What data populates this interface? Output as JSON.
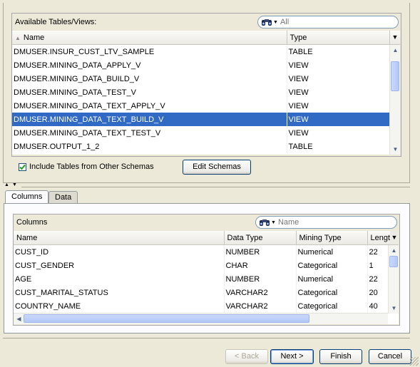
{
  "tables_panel": {
    "title": "Available Tables/Views:",
    "search_placeholder": "All",
    "columns": [
      "Name",
      "Type"
    ],
    "rows": [
      {
        "name": "DMUSER.INSUR_CUST_LTV_SAMPLE",
        "type": "TABLE"
      },
      {
        "name": "DMUSER.MINING_DATA_APPLY_V",
        "type": "VIEW"
      },
      {
        "name": "DMUSER.MINING_DATA_BUILD_V",
        "type": "VIEW"
      },
      {
        "name": "DMUSER.MINING_DATA_TEST_V",
        "type": "VIEW"
      },
      {
        "name": "DMUSER.MINING_DATA_TEXT_APPLY_V",
        "type": "VIEW"
      },
      {
        "name": "DMUSER.MINING_DATA_TEXT_BUILD_V",
        "type": "VIEW"
      },
      {
        "name": "DMUSER.MINING_DATA_TEXT_TEST_V",
        "type": "VIEW"
      },
      {
        "name": "DMUSER.OUTPUT_1_2",
        "type": "TABLE"
      }
    ],
    "selected_index": 5,
    "include_other_schemas_label": "Include Tables from Other Schemas",
    "include_other_schemas_checked": true,
    "edit_schemas_label": "Edit Schemas"
  },
  "tabs": [
    "Columns",
    "Data"
  ],
  "active_tab": 0,
  "columns_panel": {
    "title": "Columns",
    "search_placeholder": "Name",
    "headers": [
      "Name",
      "Data Type",
      "Mining Type",
      "Lengt"
    ],
    "rows": [
      {
        "name": "CUST_ID",
        "data_type": "NUMBER",
        "mining_type": "Numerical",
        "length": "22"
      },
      {
        "name": "CUST_GENDER",
        "data_type": "CHAR",
        "mining_type": "Categorical",
        "length": "1"
      },
      {
        "name": "AGE",
        "data_type": "NUMBER",
        "mining_type": "Numerical",
        "length": "22"
      },
      {
        "name": "CUST_MARITAL_STATUS",
        "data_type": "VARCHAR2",
        "mining_type": "Categorical",
        "length": "20"
      },
      {
        "name": "COUNTRY_NAME",
        "data_type": "VARCHAR2",
        "mining_type": "Categorical",
        "length": "40"
      }
    ]
  },
  "buttons": {
    "back": "< Back",
    "next": "Next >",
    "finish": "Finish",
    "cancel": "Cancel"
  },
  "colors": {
    "selection": "#316ac5",
    "background": "#ece9d8"
  }
}
